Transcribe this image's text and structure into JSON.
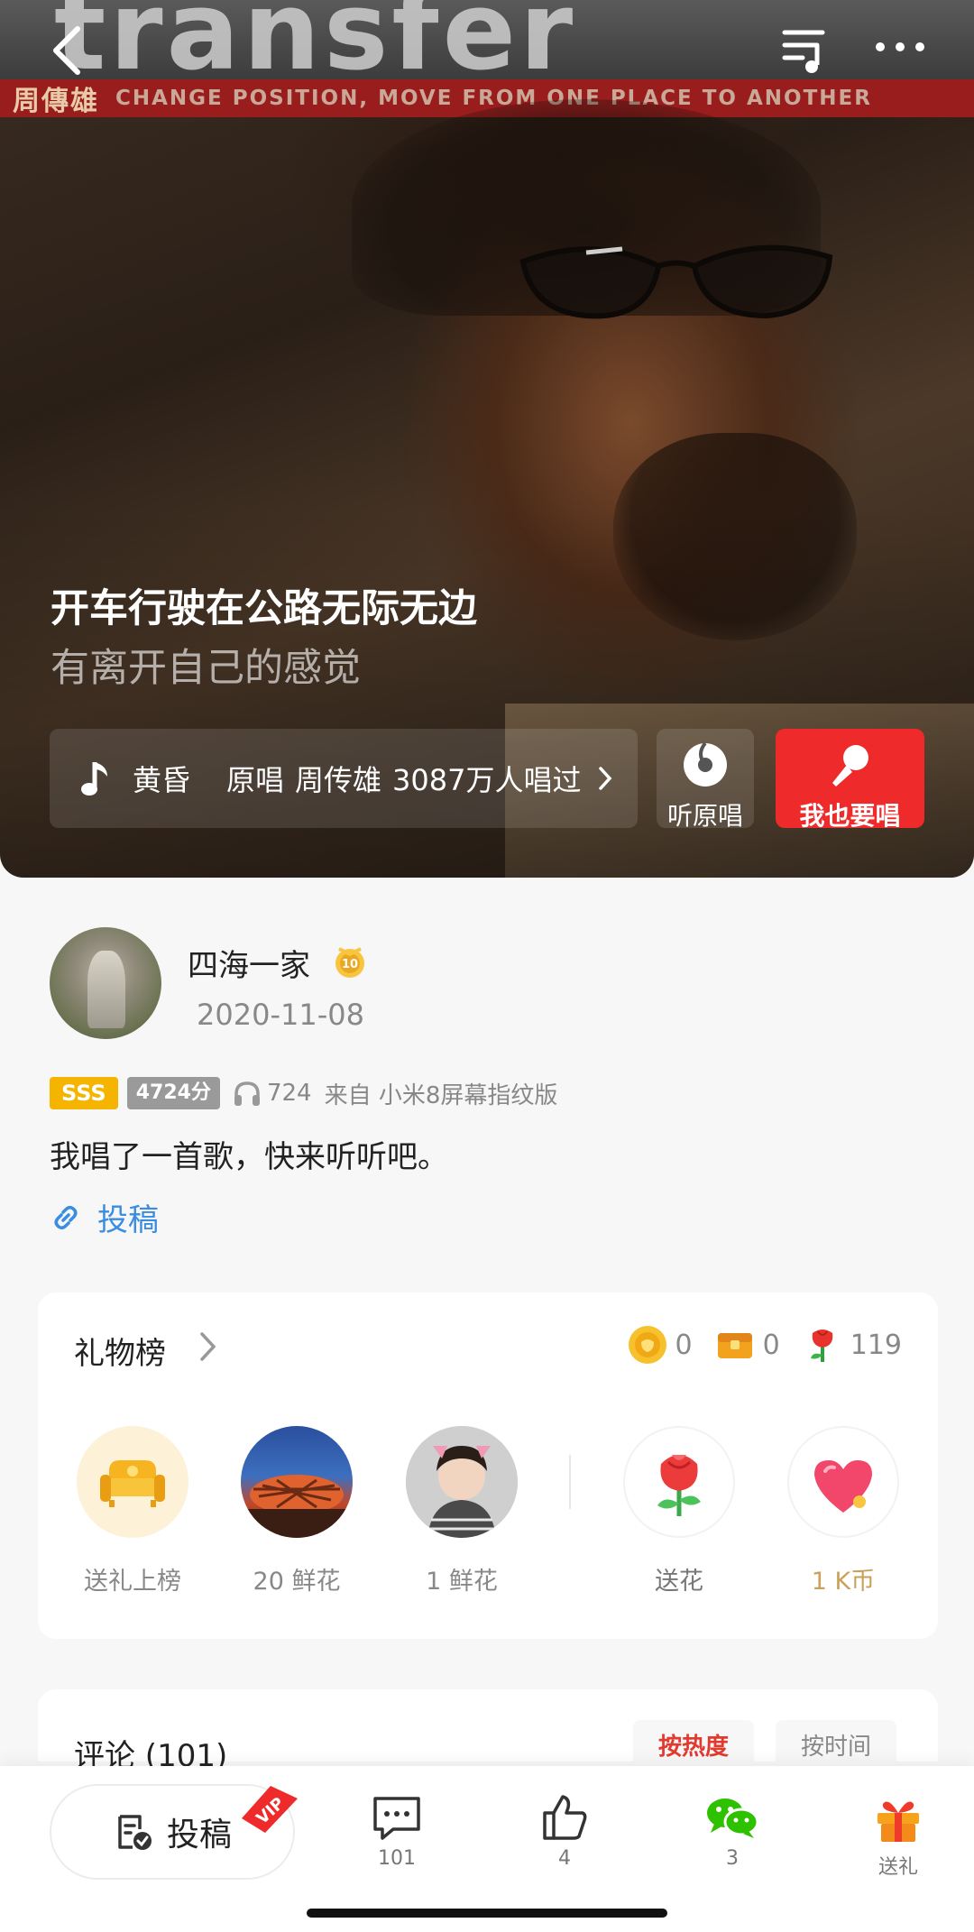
{
  "hero": {
    "banner_name": "周傳雄",
    "banner_subtitle": "CHANGE POSITION, MOVE FROM ONE PLACE TO ANOTHER",
    "lyric_current": "开车行驶在公路无际无边",
    "lyric_next": "有离开自己的感觉",
    "song_name": "黄昏",
    "original_singer_label": "原唱",
    "original_singer": "周传雄",
    "sung_count": "3087万人唱过",
    "listen_original_label": "听原唱",
    "sing_too_label": "我也要唱"
  },
  "user": {
    "name": "四海一家",
    "level": "10",
    "date": "2020-11-08",
    "grade_tag": "SSS",
    "score_tag": "4724分",
    "play_count": "724",
    "device": "来自 小米8屏幕指纹版",
    "description": "我唱了一首歌，快来听听吧。",
    "submit_link": "投稿"
  },
  "gifts": {
    "title": "礼物榜",
    "stats": [
      {
        "icon": "coin-icon",
        "value": "0"
      },
      {
        "icon": "treasure-chest-icon",
        "value": "0"
      },
      {
        "icon": "flower-icon",
        "value": "119"
      }
    ],
    "ranking": [
      {
        "label": "送礼上榜",
        "icon": "sofa-icon"
      },
      {
        "label": "20 鲜花",
        "icon": "bird-nest-avatar"
      },
      {
        "label": "1 鲜花",
        "icon": "child-avatar"
      }
    ],
    "actions": [
      {
        "label": "送花",
        "icon": "flower-gift-icon"
      },
      {
        "label": "1 K币",
        "icon": "heart-gift-icon"
      }
    ]
  },
  "comments": {
    "title": "评论 (101)",
    "sort_hot": "按热度",
    "sort_time": "按时间"
  },
  "bottom_bar": {
    "submit_label": "投稿",
    "vip_label": "VIP",
    "comment_count": "101",
    "like_count": "4",
    "share_count": "3",
    "gift_label": "送礼"
  },
  "colors": {
    "accent_red": "#ee2a2a",
    "link_blue": "#3a8de0",
    "gold": "#f5b400",
    "k_coin_gold": "#c9a25a"
  }
}
